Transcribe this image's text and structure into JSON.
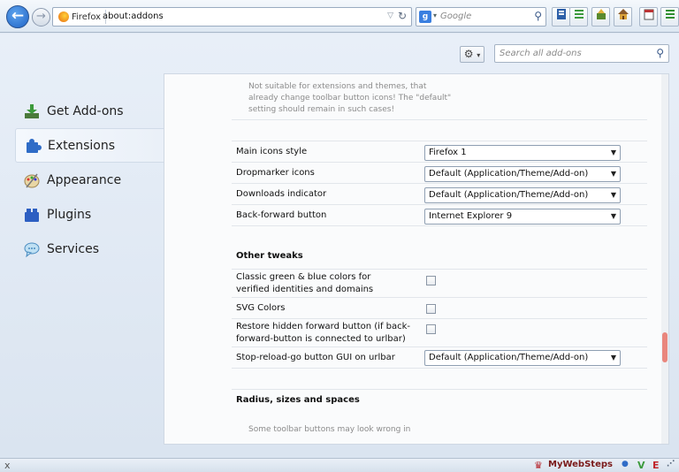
{
  "toolbar": {
    "identity_label": "Firefox",
    "url": "about:addons",
    "search_engine_letter": "g",
    "search_placeholder": "Google"
  },
  "addons_header": {
    "search_placeholder": "Search all add-ons"
  },
  "categories": [
    {
      "label": "Get Add-ons",
      "icon": "download-icon"
    },
    {
      "label": "Extensions",
      "icon": "puzzle-icon",
      "selected": true
    },
    {
      "label": "Appearance",
      "icon": "palette-icon"
    },
    {
      "label": "Plugins",
      "icon": "plugin-blocks-icon"
    },
    {
      "label": "Services",
      "icon": "speech-bubble-icon"
    }
  ],
  "pane": {
    "top_note": "Not suitable for extensions and themes, that already change toolbar button icons! The \"default\" setting should remain in such cases!",
    "settings": [
      {
        "label": "Main icons style",
        "value": "Firefox 1"
      },
      {
        "label": "Dropmarker icons",
        "value": "Default (Application/Theme/Add-on)"
      },
      {
        "label": "Downloads indicator",
        "value": "Default (Application/Theme/Add-on)"
      },
      {
        "label": "Back-forward button",
        "value": "Internet Explorer 9"
      }
    ],
    "other_tweaks_title": "Other tweaks",
    "tweaks": [
      {
        "label": "Classic green & blue colors for verified identities and domains",
        "type": "checkbox"
      },
      {
        "label": "SVG Colors",
        "type": "checkbox"
      },
      {
        "label": "Restore hidden forward button (if back-forward-button is connected to urlbar)",
        "type": "checkbox"
      },
      {
        "label": "Stop-reload-go button GUI on urlbar",
        "type": "select",
        "value": "Default (Application/Theme/Add-on)"
      }
    ],
    "radius_title": "Radius, sizes and spaces",
    "bottom_note": "Some toolbar buttons may look wrong in"
  },
  "statusbar": {
    "close": "x",
    "mywebsteps": "MyWebSteps",
    "v_label": "V",
    "e_label": "E"
  },
  "colors": {
    "accent": "#1f63c6",
    "scroll_thumb": "#e9867d"
  }
}
